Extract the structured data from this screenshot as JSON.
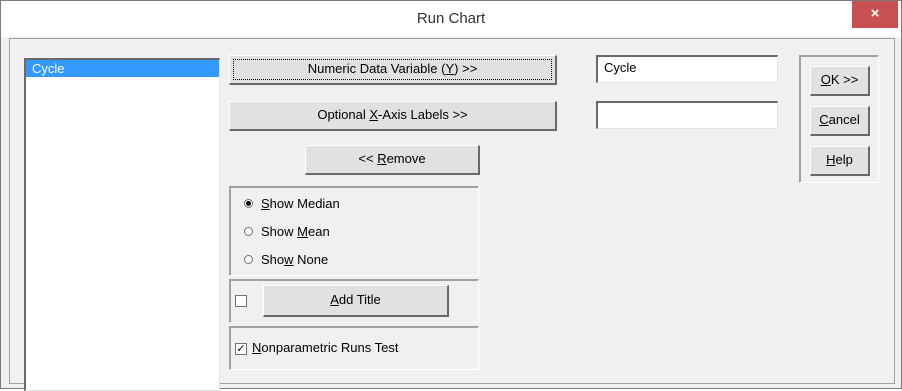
{
  "window": {
    "title": "Run Chart",
    "close_glyph": "×"
  },
  "variables_list": {
    "items": [
      "Cycle"
    ]
  },
  "buttons": {
    "numeric_pre": "Numeric Data Variable (",
    "numeric_key": "Y",
    "numeric_post": ") >>",
    "xaxis_pre": "Optional ",
    "xaxis_key": "X",
    "xaxis_post": "-Axis Labels >>",
    "remove_pre": "<< ",
    "remove_key": "R",
    "remove_post": "emove",
    "ok_key": "O",
    "ok_post": "K >>",
    "cancel_key": "C",
    "cancel_post": "ancel",
    "help_key": "H",
    "help_post": "elp",
    "addtitle_key": "A",
    "addtitle_post": "dd Title"
  },
  "fields": {
    "numeric_value": "Cycle",
    "xaxis_value": ""
  },
  "options": {
    "median_key": "S",
    "median_post": "how Median",
    "mean_pre": "Show ",
    "mean_key": "M",
    "mean_post": "ean",
    "none_pre": "Sho",
    "none_key": "w",
    "none_post": " None",
    "selected": "median"
  },
  "checks": {
    "addtitle_checked": false,
    "runs_key": "N",
    "runs_post": "onparametric Runs Test",
    "runs_checked": true,
    "check_glyph": "✓"
  }
}
